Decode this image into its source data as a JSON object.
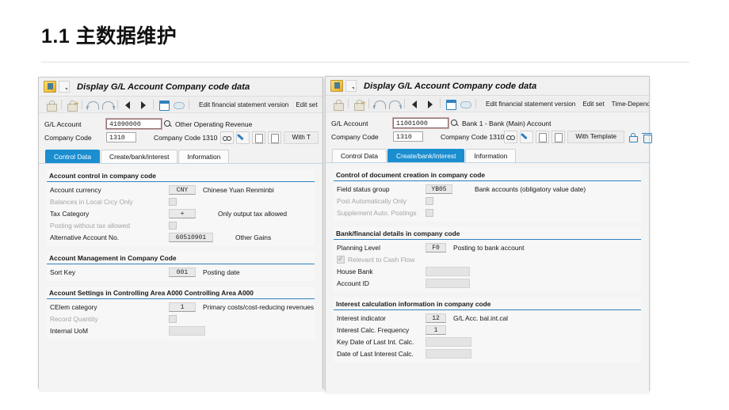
{
  "slide": {
    "title": "1.1 主数据维护"
  },
  "left_window": {
    "title": "Display G/L Account Company code data",
    "toolbar": {
      "icons": [
        "lock-icon",
        "lock-star-icon",
        "undo-icon",
        "redo-icon",
        "previous-icon",
        "next-icon",
        "calendar-icon",
        "cloud-icon"
      ],
      "buttons": [
        "Edit financial statement version",
        "Edit set"
      ]
    },
    "key_fields": {
      "gl_account_label": "G/L Account",
      "gl_account_value": "41090000",
      "gl_account_desc": "Other Operating Revenue",
      "company_code_label": "Company Code",
      "company_code_value": "1310",
      "company_code_desc": "Company Code 1310",
      "with_template_label": "With T"
    },
    "tabs": [
      {
        "label": "Control Data",
        "active": true
      },
      {
        "label": "Create/bank/interest",
        "active": false
      },
      {
        "label": "Information",
        "active": false
      }
    ],
    "groups": [
      {
        "title": "Account control in company code",
        "rows": [
          {
            "label": "Account currency",
            "value": "CNY",
            "desc": "Chinese Yuan Renminbi",
            "kind": "value",
            "dim": false
          },
          {
            "label": "Balances in Local Crcy Only",
            "checked": false,
            "kind": "checkbox",
            "dim": true
          },
          {
            "label": "Tax Category",
            "value": "+",
            "desc": "Only output tax allowed",
            "kind": "value",
            "dim": false
          },
          {
            "label": "Posting without tax allowed",
            "checked": false,
            "kind": "checkbox",
            "dim": true
          },
          {
            "label": "Alternative Account No.",
            "value": "60510901",
            "desc": "Other Gains",
            "kind": "value",
            "dim": false
          }
        ]
      },
      {
        "title": "Account Management in Company Code",
        "rows": [
          {
            "label": "Sort Key",
            "value": "001",
            "desc": "Posting date",
            "kind": "value",
            "dim": false
          }
        ]
      },
      {
        "title": "Account Settings in Controlling Area A000 Controlling Area A000",
        "rows": [
          {
            "label": "CElem category",
            "value": "1",
            "desc": "Primary costs/cost-reducing revenues",
            "kind": "value",
            "dim": false
          },
          {
            "label": "Record Quantity",
            "checked": false,
            "kind": "checkbox",
            "dim": true
          },
          {
            "label": "Internal UoM",
            "value": "",
            "desc": "",
            "kind": "blank",
            "dim": false
          }
        ]
      }
    ]
  },
  "right_window": {
    "title": "Display G/L Account Company code data",
    "toolbar": {
      "icons": [
        "lock-icon",
        "lock-star-icon",
        "undo-icon",
        "redo-icon",
        "previous-icon",
        "next-icon",
        "calendar-icon",
        "cloud-icon"
      ],
      "buttons": [
        "Edit financial statement version",
        "Edit set",
        "Time-Dependent Attributes"
      ]
    },
    "key_fields": {
      "gl_account_label": "G/L Account",
      "gl_account_value": "11001000",
      "gl_account_desc": "Bank 1 - Bank (Main) Account",
      "company_code_label": "Company Code",
      "company_code_value": "1310",
      "company_code_desc": "Company Code 1310",
      "with_template_label": "With Template"
    },
    "tabs": [
      {
        "label": "Control Data",
        "active": false
      },
      {
        "label": "Create/bank/interest",
        "active": true
      },
      {
        "label": "Information",
        "active": false
      }
    ],
    "groups": [
      {
        "title": "Control of document creation in company code",
        "rows": [
          {
            "label": "Field status group",
            "value": "YB05",
            "desc": "Bank accounts (obligatory value date)",
            "kind": "value",
            "dim": false
          },
          {
            "label": "Post Automatically Only",
            "checked": false,
            "kind": "checkbox",
            "dim": true
          },
          {
            "label": "Supplement Auto. Postings",
            "checked": false,
            "kind": "checkbox",
            "dim": true
          }
        ]
      },
      {
        "title": "Bank/financial details in company code",
        "rows": [
          {
            "label": "Planning Level",
            "value": "F0",
            "desc": "Posting to bank account",
            "kind": "value",
            "dim": false
          },
          {
            "label": "Relevant to Cash Flow",
            "checked": true,
            "kind": "checkbox",
            "dim": true
          },
          {
            "label": "House Bank",
            "value": "",
            "desc": "",
            "kind": "blank",
            "dim": false
          },
          {
            "label": "Account ID",
            "value": "",
            "desc": "",
            "kind": "blank",
            "dim": false
          }
        ]
      },
      {
        "title": "Interest calculation information in company code",
        "rows": [
          {
            "label": "Interest indicator",
            "value": "12",
            "desc": "G/L Acc. bal.int.cal",
            "kind": "value",
            "dim": false
          },
          {
            "label": "Interest Calc. Frequency",
            "value": "1",
            "desc": "",
            "kind": "value",
            "dim": false
          },
          {
            "label": "Key Date of Last Int. Calc.",
            "value": "",
            "desc": "",
            "kind": "blankdate",
            "dim": false
          },
          {
            "label": "Date of Last Interest Calc.",
            "value": "",
            "desc": "",
            "kind": "blankdate",
            "dim": false
          }
        ]
      }
    ]
  }
}
